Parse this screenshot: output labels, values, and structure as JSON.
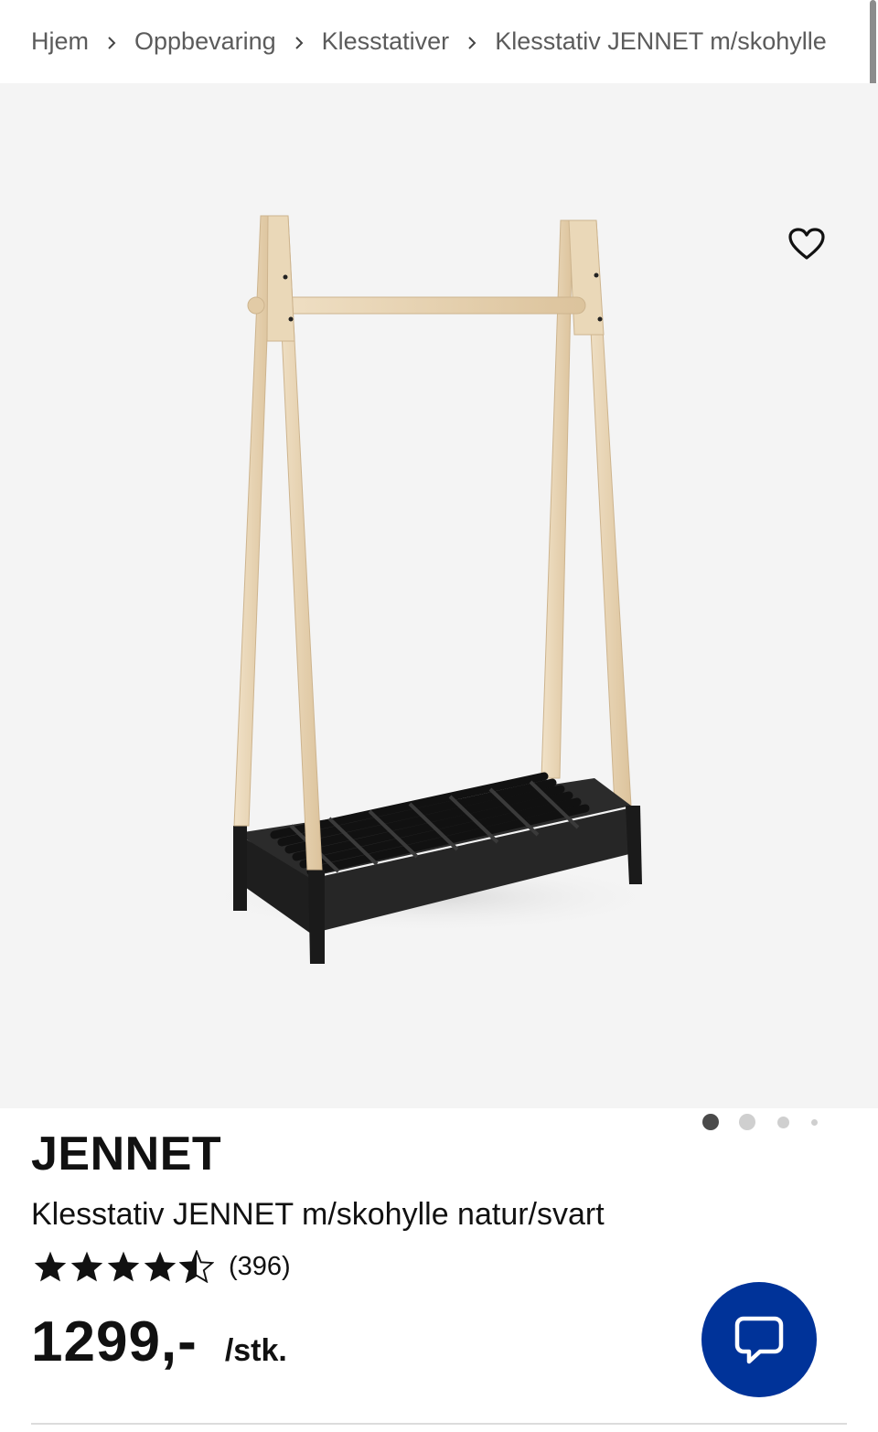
{
  "breadcrumb": {
    "items": [
      {
        "label": "Hjem"
      },
      {
        "label": "Oppbevaring"
      },
      {
        "label": "Klesstativer"
      },
      {
        "label": "Klesstativ JENNET m/skohylle"
      }
    ]
  },
  "gallery": {
    "image_alt": "Klesstativ JENNET m/skohylle natur/svart",
    "dots": [
      {
        "active": true
      },
      {
        "active": false
      },
      {
        "active": false
      },
      {
        "active": false
      }
    ],
    "favorite_icon": "heart-outline-icon"
  },
  "product": {
    "brand": "JENNET",
    "subtitle": "Klesstativ JENNET m/skohylle natur/svart",
    "rating": {
      "value": 4.5,
      "max": 5,
      "count_label": "(396)"
    },
    "price": "1299,-",
    "unit": "/stk."
  },
  "chat": {
    "icon": "chat-bubble-icon"
  },
  "colors": {
    "chat_button": "#003399",
    "gallery_bg": "#f4f4f4",
    "text": "#111111",
    "breadcrumb_text": "#5b5b5b",
    "wood": "#e8d4b4",
    "shelf": "#1f1f1f"
  }
}
